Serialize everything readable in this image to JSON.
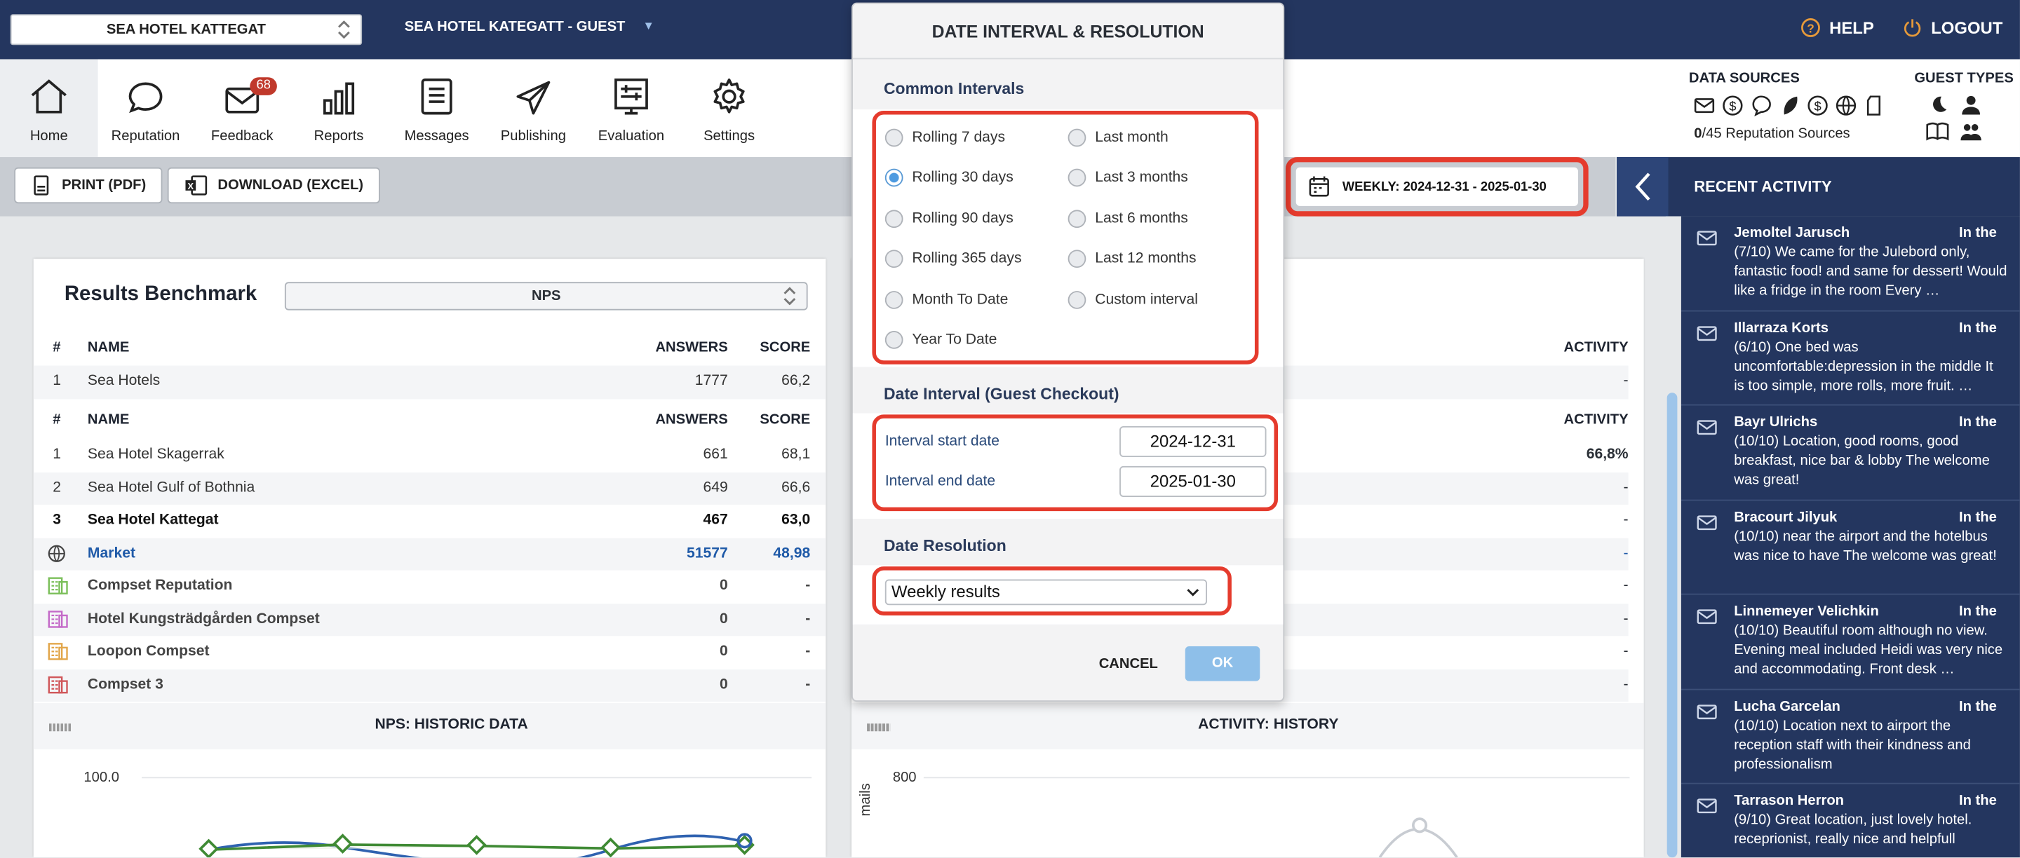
{
  "topbar": {
    "hotel_select": "SEA HOTEL KATTEGAT",
    "guest_label": "SEA HOTEL KATEGATT - GUEST",
    "help": "HELP",
    "logout": "LOGOUT"
  },
  "nav": [
    {
      "label": "Home",
      "icon": "home-icon"
    },
    {
      "label": "Reputation",
      "icon": "chat-bubble-icon"
    },
    {
      "label": "Feedback",
      "icon": "mail-icon",
      "badge": "68"
    },
    {
      "label": "Reports",
      "icon": "bar-chart-icon"
    },
    {
      "label": "Messages",
      "icon": "document-icon"
    },
    {
      "label": "Publishing",
      "icon": "paper-plane-icon"
    },
    {
      "label": "Evaluation",
      "icon": "evaluation-icon"
    },
    {
      "label": "Settings",
      "icon": "gear-icon"
    }
  ],
  "sources": {
    "data_sources_title": "DATA SOURCES",
    "guest_types_title": "GUEST TYPES",
    "rep_count": "0",
    "rep_text": "/45 Reputation Sources"
  },
  "toolbar": {
    "print": "PRINT (PDF)",
    "download": "DOWNLOAD (EXCEL)",
    "date_range": "WEEKLY: 2024-12-31 - 2025-01-30"
  },
  "benchmark": {
    "title": "Results Benchmark",
    "metric": "NPS",
    "headers": {
      "num": "#",
      "name": "NAME",
      "answers": "ANSWERS",
      "score": "SCORE",
      "activity": "ACTIVITY"
    },
    "group_row": {
      "num": "1",
      "name": "Sea Hotels",
      "answers": "1777",
      "score": "66,2",
      "activity": "-"
    },
    "rows": [
      {
        "num": "1",
        "name": "Sea Hotel Skagerrak",
        "answers": "661",
        "score": "68,1",
        "activity": "66,8%"
      },
      {
        "num": "2",
        "name": "Sea Hotel Gulf of Bothnia",
        "answers": "649",
        "score": "66,6",
        "activity": "-"
      },
      {
        "num": "3",
        "name": "Sea Hotel Kattegat",
        "answers": "467",
        "score": "63,0",
        "activity": "-"
      },
      {
        "num": "",
        "name": "Market",
        "answers": "51577",
        "score": "48,98",
        "activity": "-"
      },
      {
        "num": "",
        "name": "Compset Reputation",
        "answers": "0",
        "score": "-",
        "activity": "-"
      },
      {
        "num": "",
        "name": "Hotel Kungsträdgården Compset",
        "answers": "0",
        "score": "-",
        "activity": "-"
      },
      {
        "num": "",
        "name": "Loopon Compset",
        "answers": "0",
        "score": "-",
        "activity": "-"
      },
      {
        "num": "",
        "name": "Compset 3",
        "answers": "0",
        "score": "-",
        "activity": "-"
      }
    ],
    "compset_colors": [
      "#7bbf5a",
      "#c46ac8",
      "#e2a64a",
      "#d0575a"
    ]
  },
  "history": {
    "nps_title": "NPS: HISTORIC DATA",
    "activity_title": "ACTIVITY: HISTORY",
    "nps_ymax": "100.0",
    "activity_ymax": "800",
    "activity_ylabel": "mails"
  },
  "modal": {
    "title": "DATE INTERVAL & RESOLUTION",
    "common_title": "Common Intervals",
    "intervals_left": [
      "Rolling 7 days",
      "Rolling 30 days",
      "Rolling 90 days",
      "Rolling 365 days",
      "Month To Date",
      "Year To Date"
    ],
    "intervals_right": [
      "Last month",
      "Last 3 months",
      "Last 6 months",
      "Last 12 months",
      "Custom interval"
    ],
    "selected": "Rolling 30 days",
    "date_title": "Date Interval (Guest Checkout)",
    "start_label": "Interval start date",
    "start_value": "2024-12-31",
    "end_label": "Interval end date",
    "end_value": "2025-01-30",
    "resolution_title": "Date Resolution",
    "resolution_value": "Weekly results",
    "cancel": "CANCEL",
    "ok": "OK"
  },
  "activity": {
    "title": "RECENT ACTIVITY",
    "items": [
      {
        "name": "Jemoltel Jarusch",
        "tag": "In the",
        "text": "(7/10) We came for the Julebord only, fantastic food! and same for dessert! Would like a fridge in the room Every …"
      },
      {
        "name": "Illarraza Korts",
        "tag": "In the",
        "text": "(6/10) One bed was uncomfortable:depression in the middle It is too simple, more rolls, more fruit. …"
      },
      {
        "name": "Bayr Ulrichs",
        "tag": "In the",
        "text": "(10/10) Location, good rooms, good breakfast, nice bar & lobby The welcome was great!"
      },
      {
        "name": "Bracourt Jilyuk",
        "tag": "In the",
        "text": "(10/10) near the airport and the hotelbus was nice to have The welcome was great!"
      },
      {
        "name": "Linnemeyer Velichkin",
        "tag": "In the",
        "text": "(10/10) Beautiful room although no view. Evening meal included Heidi was very nice and accommodating. Front desk …"
      },
      {
        "name": "Lucha Garcelan",
        "tag": "In the",
        "text": "(10/10) Location next to airport the reception staff with their kindness and professionalism"
      },
      {
        "name": "Tarrason Herron",
        "tag": "In the",
        "text": "(9/10) Great location, just lovely hotel. receprionist, really nice and helpfull"
      }
    ]
  },
  "colors": {
    "navy": "#24365f",
    "accent_red": "#e53b2d",
    "link_blue": "#1f5aa8",
    "ok_blue": "#8ebfe9"
  }
}
